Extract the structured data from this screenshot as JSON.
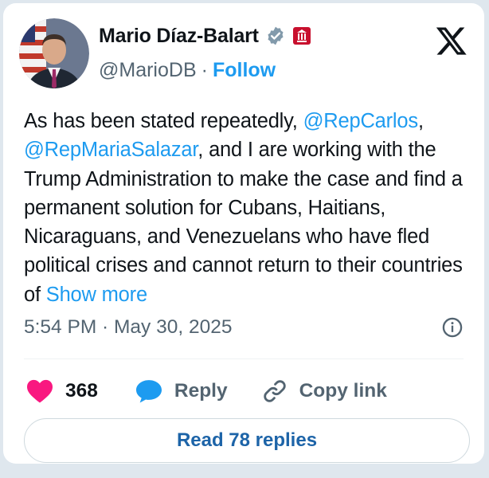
{
  "author": {
    "name": "Mario Díaz-Balart",
    "handle": "@MarioDB",
    "separator": "·",
    "follow_label": "Follow"
  },
  "tweet": {
    "parts": [
      {
        "type": "text",
        "value": "As has been stated repeatedly, "
      },
      {
        "type": "mention",
        "value": "@RepCarlos"
      },
      {
        "type": "text",
        "value": ", "
      },
      {
        "type": "mention",
        "value": "@RepMariaSalazar"
      },
      {
        "type": "text",
        "value": ", and I are working with the Trump Administration to make the case and find a permanent solution for Cubans, Haitians, Nicaraguans, and Venezuelans who have fled political crises and cannot return to their countries of "
      }
    ],
    "show_more_label": "Show more",
    "timestamp": "5:54 PM · May 30, 2025"
  },
  "actions": {
    "like_count": "368",
    "reply_label": "Reply",
    "copy_link_label": "Copy link"
  },
  "read_replies_label": "Read 78 replies",
  "colors": {
    "accent": "#1d9bf0",
    "like": "#f91880",
    "verified": "#829aab",
    "affiliation": "#c8102e"
  },
  "icons": [
    "verified-badge-icon",
    "affiliation-badge-icon",
    "x-logo-icon",
    "info-icon",
    "heart-icon",
    "speech-bubble-icon",
    "link-icon"
  ]
}
